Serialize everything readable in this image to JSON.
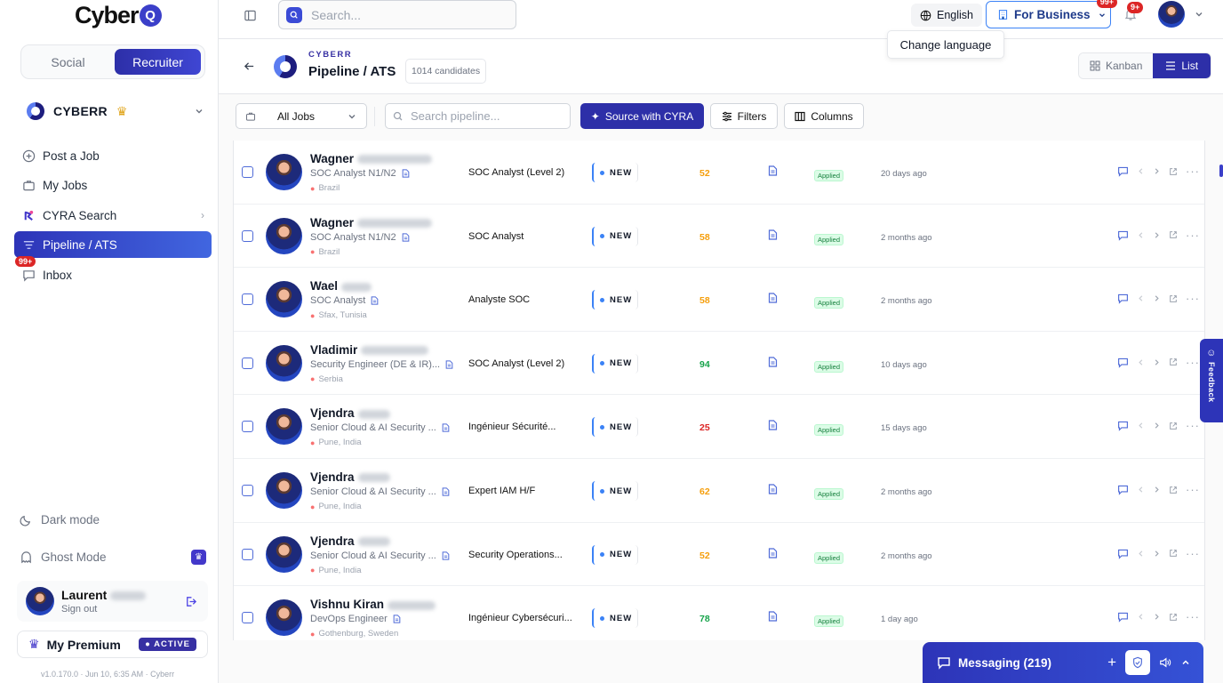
{
  "brand": {
    "logo_text": "Cyber",
    "logo_q": "Q"
  },
  "sidebar": {
    "mode_tabs": [
      {
        "label": "Social"
      },
      {
        "label": "Recruiter"
      }
    ],
    "org": {
      "name": "CYBERR"
    },
    "nav": [
      {
        "label": "Post a Job",
        "icon": "plus-circle-icon"
      },
      {
        "label": "My Jobs",
        "icon": "briefcase-icon"
      },
      {
        "label": "CYRA Search",
        "icon": "cyra-icon"
      },
      {
        "label": "Pipeline / ATS",
        "icon": "pipeline-icon"
      },
      {
        "label": "Inbox",
        "icon": "chat-icon",
        "badge": "99+"
      }
    ],
    "dark_mode_label": "Dark mode",
    "ghost_mode_label": "Ghost Mode",
    "user": {
      "first_name": "Laurent",
      "sub": "Sign out"
    },
    "premium": {
      "label": "My Premium",
      "badge": "ACTIVE"
    },
    "version": "v1.0.170.0 · Jun 10, 6:35 AM · Cyberr"
  },
  "topbar": {
    "search_placeholder": "Search...",
    "language": "English",
    "business": "For Business",
    "business_badge": "99+",
    "notif_badge": "9+",
    "tooltip": "Change language"
  },
  "header": {
    "eyebrow": "CYBERR",
    "title": "Pipeline / ATS",
    "count": "1014 candidates",
    "views": [
      {
        "label": "Kanban"
      },
      {
        "label": "List"
      }
    ]
  },
  "toolbar": {
    "jobs_filter": "All Jobs",
    "search_placeholder": "Search pipeline...",
    "source_label": "Source with CYRA",
    "filters_label": "Filters",
    "columns_label": "Columns"
  },
  "candidates": [
    {
      "first": "Wagner",
      "role": "SOC Analyst N1/N2",
      "location": "Brazil",
      "job": "SOC Analyst (Level 2)",
      "status": "NEW",
      "score": "52",
      "tag": "Applied",
      "ago": "20 days ago"
    },
    {
      "first": "Wagner",
      "role": "SOC Analyst N1/N2",
      "location": "Brazil",
      "job": "SOC Analyst",
      "status": "NEW",
      "score": "58",
      "tag": "Applied",
      "ago": "2 months ago"
    },
    {
      "first": "Wael",
      "role": "SOC Analyst",
      "location": "Sfax, Tunisia",
      "job": "Analyste SOC",
      "status": "NEW",
      "score": "58",
      "tag": "Applied",
      "ago": "2 months ago"
    },
    {
      "first": "Vladimir",
      "role": "Security Engineer (DE & IR)...",
      "location": "Serbia",
      "job": "SOC Analyst (Level 2)",
      "status": "NEW",
      "score": "94",
      "tag": "Applied",
      "ago": "10 days ago"
    },
    {
      "first": "Vjendra",
      "role": "Senior Cloud & AI Security ...",
      "location": "Pune, India",
      "job": "Ingénieur Sécurité...",
      "status": "NEW",
      "score": "25",
      "tag": "Applied",
      "ago": "15 days ago"
    },
    {
      "first": "Vjendra",
      "role": "Senior Cloud & AI Security ...",
      "location": "Pune, India",
      "job": "Expert IAM H/F",
      "status": "NEW",
      "score": "62",
      "tag": "Applied",
      "ago": "2 months ago"
    },
    {
      "first": "Vjendra",
      "role": "Senior Cloud & AI Security ...",
      "location": "Pune, India",
      "job": "Security Operations...",
      "status": "NEW",
      "score": "52",
      "tag": "Applied",
      "ago": "2 months ago"
    },
    {
      "first": "Vishnu Kiran",
      "role": "DevOps Engineer",
      "location": "Gothenburg, Sweden",
      "job": "Ingénieur Cybersécuri...",
      "status": "NEW",
      "score": "78",
      "tag": "Applied",
      "ago": "1 day ago"
    }
  ],
  "score_colors": {
    "low": "#dc2626",
    "mid": "#f59e0b",
    "high": "#16a34a"
  },
  "feedback_label": "Feedback",
  "messaging": {
    "label": "Messaging (219)"
  }
}
